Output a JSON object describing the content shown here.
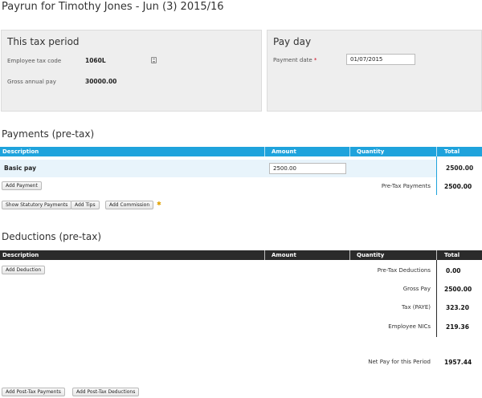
{
  "page": {
    "title": "Payrun for Timothy Jones - Jun (3) 2015/16"
  },
  "tax_period": {
    "title": "This tax period",
    "tax_code_label": "Employee tax code",
    "tax_code_value": "1060L",
    "gross_label": "Gross annual pay",
    "gross_value": "30000.00"
  },
  "pay_day": {
    "title": "Pay day",
    "date_label": "Payment date",
    "required_mark": "*",
    "date_value": "01/07/2015"
  },
  "payments": {
    "title": "Payments (pre-tax)",
    "columns": [
      "Description",
      "Amount",
      "Quantity",
      "Total"
    ],
    "rows": [
      {
        "description": "Basic pay",
        "amount": "2500.00",
        "total": "2500.00"
      }
    ],
    "add_button": "Add Payment",
    "pretax_label": "Pre-Tax Payments",
    "pretax_value": "2500.00",
    "extra_buttons": [
      "Show Statutory Payments",
      "Add Tips",
      "Add Commission"
    ]
  },
  "deductions": {
    "title": "Deductions (pre-tax)",
    "columns": [
      "Description",
      "Amount",
      "Quantity",
      "Total"
    ],
    "add_button": "Add Deduction",
    "summary": [
      {
        "label": "Pre-Tax Deductions",
        "value": "0.00"
      },
      {
        "label": "Gross Pay",
        "value": "2500.00"
      },
      {
        "label": "Tax (PAYE)",
        "value": "323.20"
      },
      {
        "label": "Employee NICs",
        "value": "219.36"
      }
    ],
    "net_label": "Net Pay for this Period",
    "net_value": "1957.44",
    "post_buttons": [
      "Add Post-Tax Payments",
      "Add Post-Tax Deductions"
    ]
  },
  "colors": {
    "payments_header": "#1fa3dc",
    "deductions_header": "#2b2b2b",
    "panel_bg": "#eeeeee"
  }
}
